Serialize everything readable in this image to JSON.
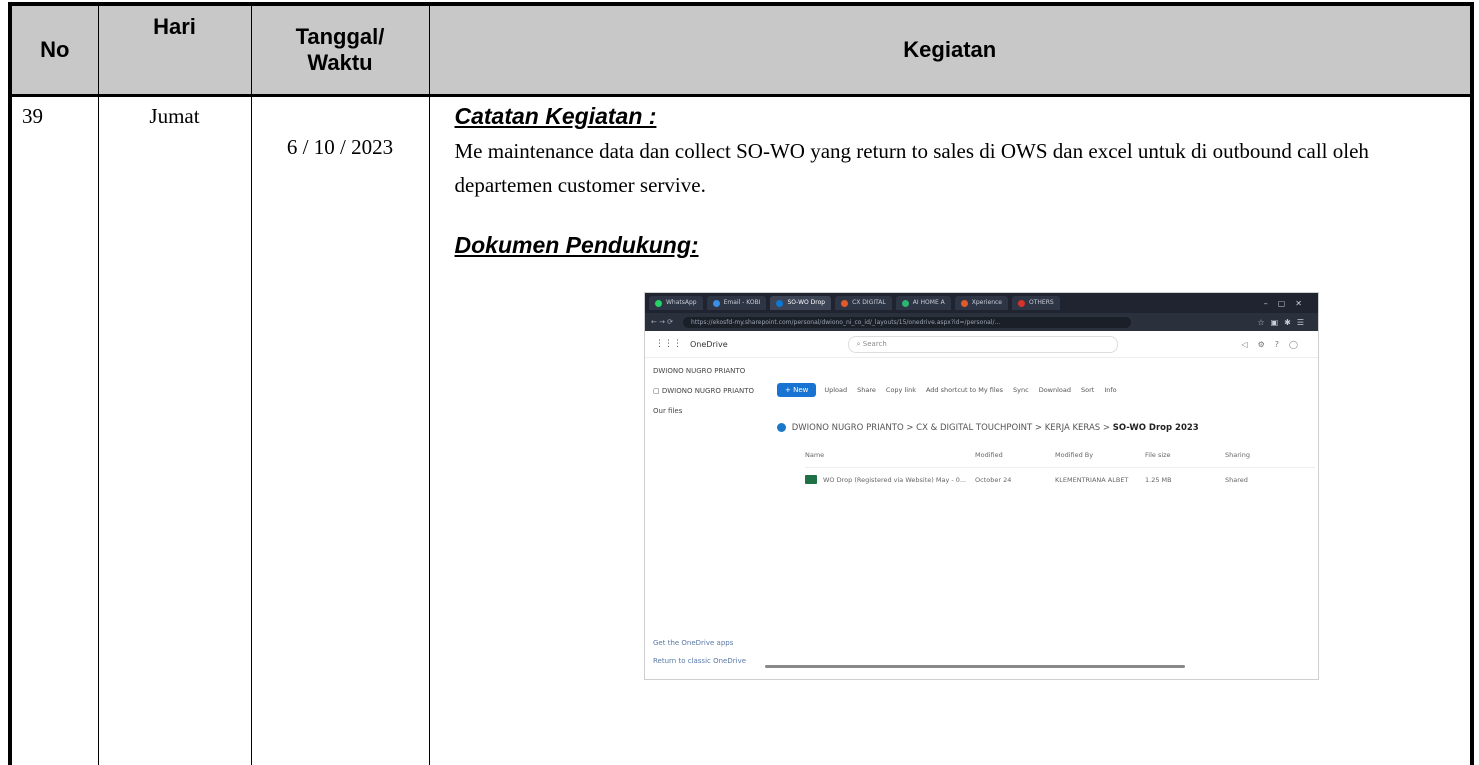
{
  "table": {
    "headers": {
      "no": "No",
      "hari": "Hari",
      "tanggal": "Tanggal/\nWaktu",
      "kegiatan": "Kegiatan"
    },
    "row": {
      "no": "39",
      "hari": "Jumat",
      "tanggal": "6 / 10 / 2023",
      "catatan_heading": "Catatan Kegiatan :",
      "catatan_text": "Me maintenance data dan collect SO-WO yang return to sales di OWS dan excel untuk  di outbound call oleh departemen customer servive.",
      "dokumen_heading": "Dokumen Pendukung:"
    }
  },
  "screenshot": {
    "tabs": [
      "WhatsApp",
      "Email - KOBI",
      "SO-WO Drop",
      "CX DIGITAL",
      "AI HOME A",
      "Xperience",
      "OTHERS"
    ],
    "address": "https://ekosfd-my.sharepoint.com/personal/dwiono_ni_co_id/_layouts/15/onedrive.aspx?id=/personal/...",
    "app_name": "OneDrive",
    "search_placeholder": "Search",
    "user": "DWIONO NUGRO PRIANTO",
    "nav_item": "DWIONO NUGRO PRIANTO",
    "nav_files": "Our files",
    "nav_get_app": "Get the OneDrive apps",
    "nav_return": "Return to classic OneDrive",
    "new_label": "+ New",
    "commands": [
      "Upload",
      "Share",
      "Copy link",
      "Add shortcut to My files",
      "Sync",
      "Download",
      "Sort",
      "Info"
    ],
    "breadcrumb": "DWIONO NUGRO PRIANTO  >  CX & DIGITAL TOUCHPOINT  >  KERJA KERAS  >",
    "breadcrumb_current": "SO-WO Drop 2023",
    "columns": [
      "Name",
      "Modified",
      "Modified By",
      "File size",
      "Sharing"
    ],
    "file": {
      "name": "WO Drop (Registered via Website) May - 0...",
      "modified": "October 24",
      "modified_by": "KLEMENTRIANA ALBET",
      "size": "1.25 MB",
      "sharing": "Shared"
    }
  }
}
